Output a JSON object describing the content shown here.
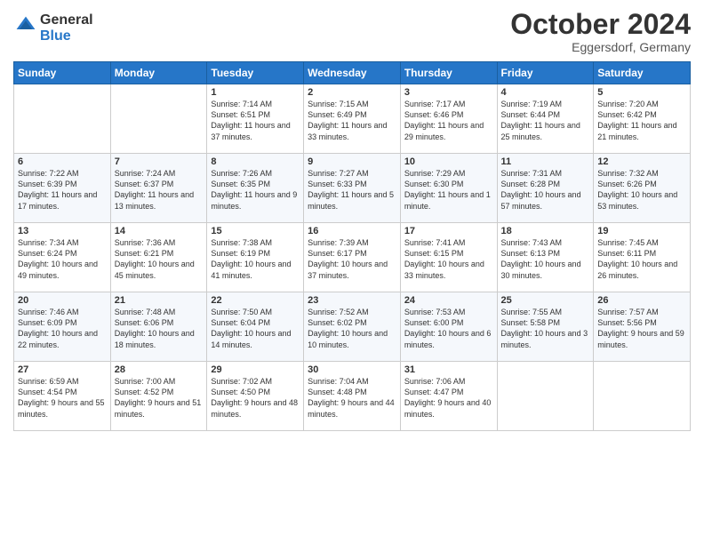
{
  "logo": {
    "line1": "General",
    "line2": "Blue"
  },
  "header": {
    "month": "October 2024",
    "location": "Eggersdorf, Germany"
  },
  "weekdays": [
    "Sunday",
    "Monday",
    "Tuesday",
    "Wednesday",
    "Thursday",
    "Friday",
    "Saturday"
  ],
  "weeks": [
    [
      {
        "day": "",
        "info": ""
      },
      {
        "day": "",
        "info": ""
      },
      {
        "day": "1",
        "info": "Sunrise: 7:14 AM\nSunset: 6:51 PM\nDaylight: 11 hours and 37 minutes."
      },
      {
        "day": "2",
        "info": "Sunrise: 7:15 AM\nSunset: 6:49 PM\nDaylight: 11 hours and 33 minutes."
      },
      {
        "day": "3",
        "info": "Sunrise: 7:17 AM\nSunset: 6:46 PM\nDaylight: 11 hours and 29 minutes."
      },
      {
        "day": "4",
        "info": "Sunrise: 7:19 AM\nSunset: 6:44 PM\nDaylight: 11 hours and 25 minutes."
      },
      {
        "day": "5",
        "info": "Sunrise: 7:20 AM\nSunset: 6:42 PM\nDaylight: 11 hours and 21 minutes."
      }
    ],
    [
      {
        "day": "6",
        "info": "Sunrise: 7:22 AM\nSunset: 6:39 PM\nDaylight: 11 hours and 17 minutes."
      },
      {
        "day": "7",
        "info": "Sunrise: 7:24 AM\nSunset: 6:37 PM\nDaylight: 11 hours and 13 minutes."
      },
      {
        "day": "8",
        "info": "Sunrise: 7:26 AM\nSunset: 6:35 PM\nDaylight: 11 hours and 9 minutes."
      },
      {
        "day": "9",
        "info": "Sunrise: 7:27 AM\nSunset: 6:33 PM\nDaylight: 11 hours and 5 minutes."
      },
      {
        "day": "10",
        "info": "Sunrise: 7:29 AM\nSunset: 6:30 PM\nDaylight: 11 hours and 1 minute."
      },
      {
        "day": "11",
        "info": "Sunrise: 7:31 AM\nSunset: 6:28 PM\nDaylight: 10 hours and 57 minutes."
      },
      {
        "day": "12",
        "info": "Sunrise: 7:32 AM\nSunset: 6:26 PM\nDaylight: 10 hours and 53 minutes."
      }
    ],
    [
      {
        "day": "13",
        "info": "Sunrise: 7:34 AM\nSunset: 6:24 PM\nDaylight: 10 hours and 49 minutes."
      },
      {
        "day": "14",
        "info": "Sunrise: 7:36 AM\nSunset: 6:21 PM\nDaylight: 10 hours and 45 minutes."
      },
      {
        "day": "15",
        "info": "Sunrise: 7:38 AM\nSunset: 6:19 PM\nDaylight: 10 hours and 41 minutes."
      },
      {
        "day": "16",
        "info": "Sunrise: 7:39 AM\nSunset: 6:17 PM\nDaylight: 10 hours and 37 minutes."
      },
      {
        "day": "17",
        "info": "Sunrise: 7:41 AM\nSunset: 6:15 PM\nDaylight: 10 hours and 33 minutes."
      },
      {
        "day": "18",
        "info": "Sunrise: 7:43 AM\nSunset: 6:13 PM\nDaylight: 10 hours and 30 minutes."
      },
      {
        "day": "19",
        "info": "Sunrise: 7:45 AM\nSunset: 6:11 PM\nDaylight: 10 hours and 26 minutes."
      }
    ],
    [
      {
        "day": "20",
        "info": "Sunrise: 7:46 AM\nSunset: 6:09 PM\nDaylight: 10 hours and 22 minutes."
      },
      {
        "day": "21",
        "info": "Sunrise: 7:48 AM\nSunset: 6:06 PM\nDaylight: 10 hours and 18 minutes."
      },
      {
        "day": "22",
        "info": "Sunrise: 7:50 AM\nSunset: 6:04 PM\nDaylight: 10 hours and 14 minutes."
      },
      {
        "day": "23",
        "info": "Sunrise: 7:52 AM\nSunset: 6:02 PM\nDaylight: 10 hours and 10 minutes."
      },
      {
        "day": "24",
        "info": "Sunrise: 7:53 AM\nSunset: 6:00 PM\nDaylight: 10 hours and 6 minutes."
      },
      {
        "day": "25",
        "info": "Sunrise: 7:55 AM\nSunset: 5:58 PM\nDaylight: 10 hours and 3 minutes."
      },
      {
        "day": "26",
        "info": "Sunrise: 7:57 AM\nSunset: 5:56 PM\nDaylight: 9 hours and 59 minutes."
      }
    ],
    [
      {
        "day": "27",
        "info": "Sunrise: 6:59 AM\nSunset: 4:54 PM\nDaylight: 9 hours and 55 minutes."
      },
      {
        "day": "28",
        "info": "Sunrise: 7:00 AM\nSunset: 4:52 PM\nDaylight: 9 hours and 51 minutes."
      },
      {
        "day": "29",
        "info": "Sunrise: 7:02 AM\nSunset: 4:50 PM\nDaylight: 9 hours and 48 minutes."
      },
      {
        "day": "30",
        "info": "Sunrise: 7:04 AM\nSunset: 4:48 PM\nDaylight: 9 hours and 44 minutes."
      },
      {
        "day": "31",
        "info": "Sunrise: 7:06 AM\nSunset: 4:47 PM\nDaylight: 9 hours and 40 minutes."
      },
      {
        "day": "",
        "info": ""
      },
      {
        "day": "",
        "info": ""
      }
    ]
  ]
}
